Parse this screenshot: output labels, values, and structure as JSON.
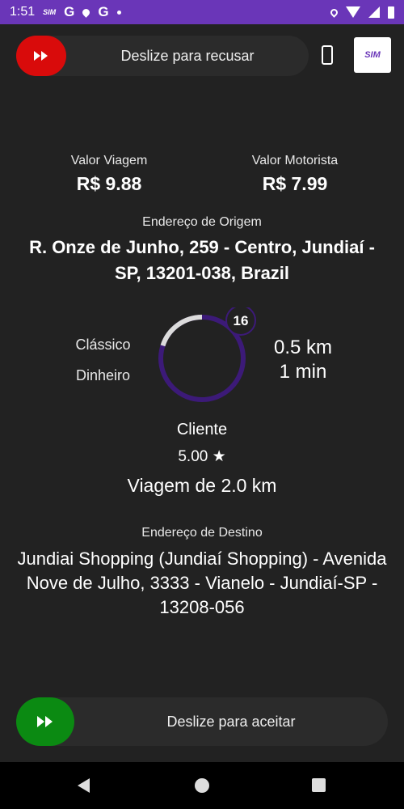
{
  "status_bar": {
    "time": "1:51",
    "sim": "SIM",
    "g1": "G",
    "g2": "G"
  },
  "top_slider": {
    "label": "Deslize para recusar",
    "color": "#d90b0b"
  },
  "logo": {
    "text": "SIM"
  },
  "fare": {
    "valor_viagem_label": "Valor Viagem",
    "valor_viagem": "R$ 9.88",
    "valor_motorista_label": "Valor Motorista",
    "valor_motorista": "R$ 7.99"
  },
  "origin": {
    "label": "Endereço de Origem",
    "address": "R. Onze de Junho, 259 - Centro, Jundiaí - SP, 13201-038, Brazil"
  },
  "trip": {
    "category": "Clássico",
    "payment": "Dinheiro",
    "countdown": "16",
    "countdown_fraction": 0.2,
    "distance_to_pickup": "0.5 km",
    "time_to_pickup": "1 min",
    "accent": "#3c1a78"
  },
  "client": {
    "label": "Cliente",
    "rating": "5.00 ★"
  },
  "trip_distance": "Viagem de 2.0 km",
  "destination": {
    "label": "Endereço de Destino",
    "address": "Jundiai Shopping (Jundiaí Shopping) - Avenida Nove de Julho, 3333 - Vianelo - Jundiaí-SP - 13208-056"
  },
  "bottom_slider": {
    "label": "Deslize para aceitar",
    "color": "#0b8a12"
  }
}
